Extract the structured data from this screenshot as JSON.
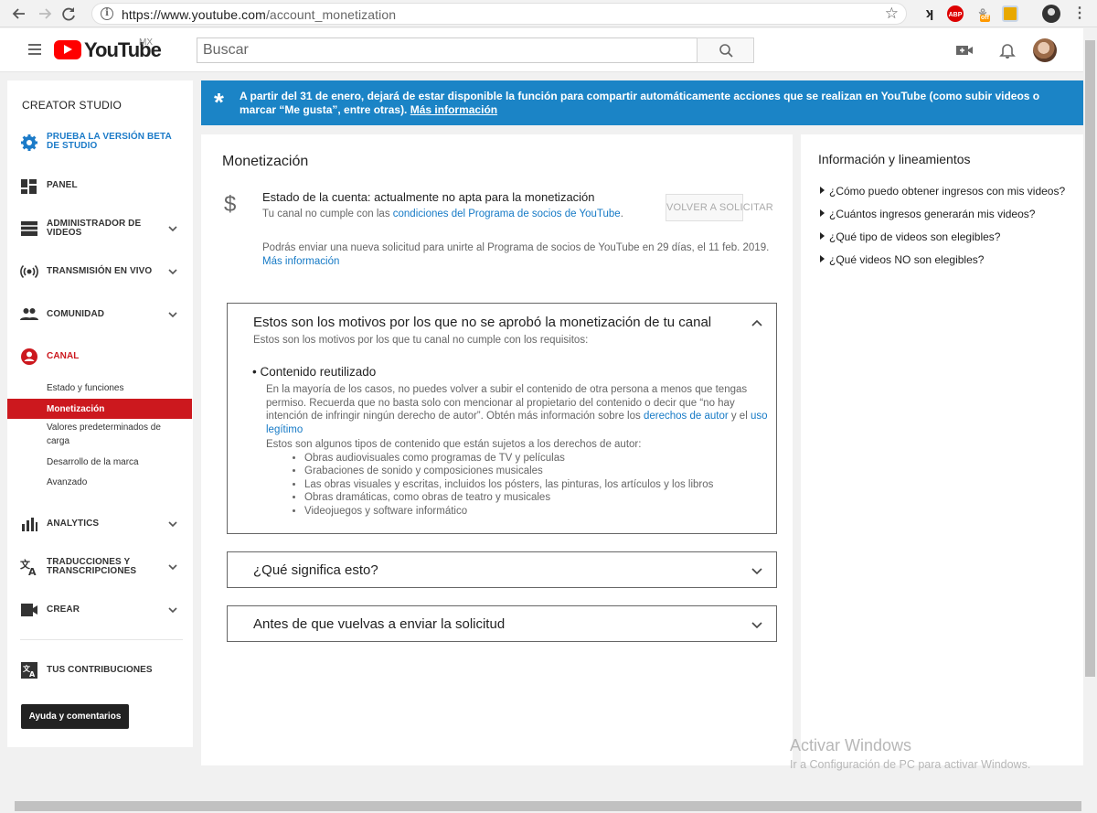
{
  "browser": {
    "url_host": "https://www.youtube.com",
    "url_path": "/account_monetization",
    "extensions": [
      "abp-icon",
      "extension-off-icon",
      "extension-icon",
      "profile-icon"
    ],
    "ext_abp": "ABP",
    "ext_off": "off"
  },
  "header": {
    "logo_text": "YouTube",
    "region": "MX",
    "search_placeholder": "Buscar"
  },
  "sidebar": {
    "title": "CREATOR STUDIO",
    "beta": "PRUEBA LA VERSIÓN BETA DE STUDIO",
    "items": [
      {
        "label": "PANEL"
      },
      {
        "label": "ADMINISTRADOR DE VIDEOS"
      },
      {
        "label": "TRANSMISIÓN EN VIVO"
      },
      {
        "label": "COMUNIDAD"
      },
      {
        "label": "CANAL"
      },
      {
        "label": "ANALYTICS"
      },
      {
        "label": "TRADUCCIONES Y TRANSCRIPCIONES"
      },
      {
        "label": "CREAR"
      },
      {
        "label": "TUS CONTRIBUCIONES"
      }
    ],
    "canal_sub": [
      "Estado y funciones",
      "Monetización",
      "Valores predeterminados de carga",
      "Desarrollo de la marca",
      "Avanzado"
    ],
    "help_button": "Ayuda y comentarios"
  },
  "banner": {
    "text": "A partir del 31 de enero, dejará de estar disponible la función para compartir automáticamente acciones que se realizan en YouTube (como subir videos o marcar “Me gusta”, entre otras).",
    "link": "Más información"
  },
  "main": {
    "title": "Monetización",
    "status_title": "Estado de la cuenta: actualmente no apta para la monetización",
    "status_sub_prefix": "Tu canal no cumple con las ",
    "status_sub_link": "condiciones del Programa de socios de YouTube",
    "status_sub_suffix": ".",
    "reapply_button": "VOLVER A SOLICITAR",
    "reapply_note": "Podrás enviar una nueva solicitud para unirte al Programa de socios de YouTube en 29 días, el 11 feb. 2019.",
    "reapply_link": "Más información",
    "panel1": {
      "title": "Estos son los motivos por los que no se aprobó la monetización de tu canal",
      "subtitle": "Estos son los motivos por los que tu canal no cumple con los requisitos:",
      "reason": "Contenido reutilizado",
      "body_1": "En la mayoría de los casos, no puedes volver a subir el contenido de otra persona a menos que tengas permiso. Recuerda que no basta solo con mencionar al propietario del contenido o decir que “no hay intención de infringir ningún derecho de autor”. Obtén más información sobre los ",
      "link_1": "derechos de autor",
      "body_2": " y el ",
      "link_2": "uso legítimo",
      "list_intro": "Estos son algunos tipos de contenido que están sujetos a los derechos de autor:",
      "list": [
        "Obras audiovisuales como programas de TV y películas",
        "Grabaciones de sonido y composiciones musicales",
        "Las obras visuales y escritas, incluidos los pósters, las pinturas, los artículos y los libros",
        "Obras dramáticas, como obras de teatro y musicales",
        "Videojuegos y software informático"
      ]
    },
    "panel2": {
      "title": "¿Qué significa esto?"
    },
    "panel3": {
      "title": "Antes de que vuelvas a enviar la solicitud"
    }
  },
  "right": {
    "title": "Información y lineamientos",
    "links": [
      "¿Cómo puedo obtener ingresos con mis videos?",
      "¿Cuántos ingresos generarán mis videos?",
      "¿Qué tipo de videos son elegibles?",
      "¿Qué videos NO son elegibles?"
    ]
  },
  "watermark": {
    "line1": "Activar Windows",
    "line2": "Ir a Configuración de PC para activar Windows."
  }
}
